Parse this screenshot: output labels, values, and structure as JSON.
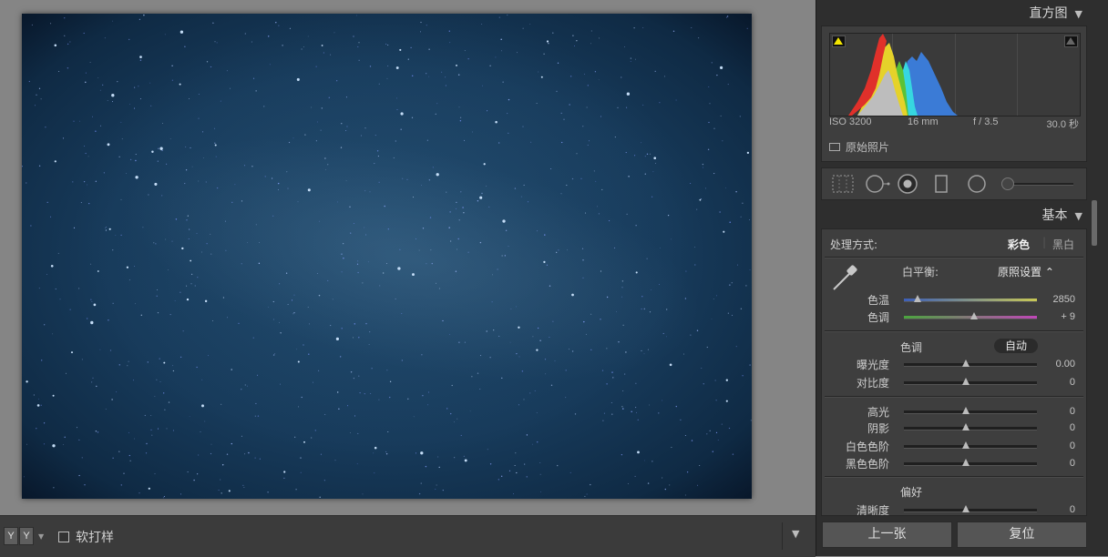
{
  "viewer": {
    "image_description": ""
  },
  "toolbar": {
    "yy_left": "Y",
    "yy_right": "Y",
    "softproof_label": "软打样"
  },
  "histogram": {
    "title": "直方图",
    "iso": "ISO 3200",
    "focal": "16 mm",
    "aperture": "f / 3.5",
    "shutter": "30.0 秒",
    "original_photo_label": "原始照片"
  },
  "basic": {
    "title": "基本",
    "treatment_label": "处理方式:",
    "treatment_color": "彩色",
    "treatment_bw": "黑白",
    "wb_label": "白平衡:",
    "wb_value": "原照设置 ⌃",
    "temp_label": "色温",
    "temp_value": "2850",
    "temp_fraction": 0.1,
    "tint_label": "色调",
    "tint_value": "+ 9",
    "tint_fraction": 0.53,
    "tone_label": "色调",
    "auto_label": "自动",
    "exposure_label": "曝光度",
    "exposure_value": "0.00",
    "contrast_label": "对比度",
    "contrast_value": "0",
    "highlights_label": "高光",
    "highlights_value": "0",
    "shadows_label": "阴影",
    "shadows_value": "0",
    "whites_label": "白色色阶",
    "whites_value": "0",
    "blacks_label": "黑色色阶",
    "blacks_value": "0",
    "presence_label": "偏好",
    "clarity_label": "清晰度",
    "clarity_value": "0"
  },
  "footer": {
    "previous_label": "上一张",
    "reset_label": "复位"
  },
  "colors": {
    "panel_bg": "#2e2e2e",
    "section_bg": "#3e3e3e",
    "histogram_red": "#e0302a",
    "histogram_yellow": "#e5d22a",
    "histogram_green": "#5bc236",
    "histogram_cyan": "#36d7e0",
    "histogram_blue": "#3b7bd6",
    "photo_base": "#1b3f62"
  }
}
